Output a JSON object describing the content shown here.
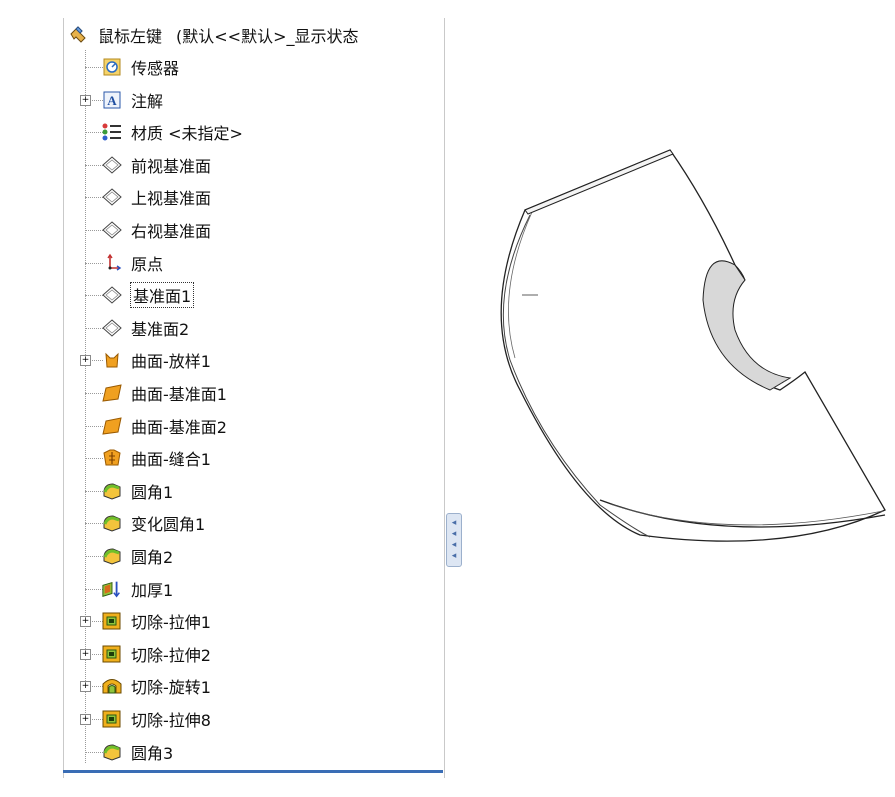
{
  "tree": {
    "root": {
      "label": "鼠标左键",
      "config": "(默认<<默认>_显示状态",
      "icon": "part-icon"
    },
    "items": [
      {
        "label": "传感器",
        "icon": "sensor-icon",
        "expandable": false
      },
      {
        "label": "注解",
        "icon": "annotation-icon",
        "expandable": true
      },
      {
        "label": "材质 <未指定>",
        "icon": "material-icon",
        "expandable": false
      },
      {
        "label": "前视基准面",
        "icon": "plane-icon",
        "expandable": false
      },
      {
        "label": "上视基准面",
        "icon": "plane-icon",
        "expandable": false
      },
      {
        "label": "右视基准面",
        "icon": "plane-icon",
        "expandable": false
      },
      {
        "label": "原点",
        "icon": "origin-icon",
        "expandable": false
      },
      {
        "label": "基准面1",
        "icon": "plane-icon",
        "expandable": false,
        "selected": true
      },
      {
        "label": "基准面2",
        "icon": "plane-icon",
        "expandable": false
      },
      {
        "label": "曲面-放样1",
        "icon": "surface-loft-icon",
        "expandable": true
      },
      {
        "label": "曲面-基准面1",
        "icon": "planar-surface-icon",
        "expandable": false
      },
      {
        "label": "曲面-基准面2",
        "icon": "planar-surface-icon",
        "expandable": false
      },
      {
        "label": "曲面-缝合1",
        "icon": "knit-surface-icon",
        "expandable": false
      },
      {
        "label": "圆角1",
        "icon": "fillet-icon",
        "expandable": false
      },
      {
        "label": "变化圆角1",
        "icon": "fillet-icon",
        "expandable": false
      },
      {
        "label": "圆角2",
        "icon": "fillet-icon",
        "expandable": false
      },
      {
        "label": "加厚1",
        "icon": "thicken-icon",
        "expandable": false
      },
      {
        "label": "切除-拉伸1",
        "icon": "cut-extrude-icon",
        "expandable": true
      },
      {
        "label": "切除-拉伸2",
        "icon": "cut-extrude-icon",
        "expandable": true
      },
      {
        "label": "切除-旋转1",
        "icon": "cut-revolve-icon",
        "expandable": true
      },
      {
        "label": "切除-拉伸8",
        "icon": "cut-extrude-icon",
        "expandable": true
      },
      {
        "label": "圆角3",
        "icon": "fillet-icon",
        "expandable": false
      }
    ]
  },
  "colors": {
    "panel_border": "#3a6db5",
    "feature_orange": "#f0a020",
    "feature_green": "#8fc43c"
  }
}
